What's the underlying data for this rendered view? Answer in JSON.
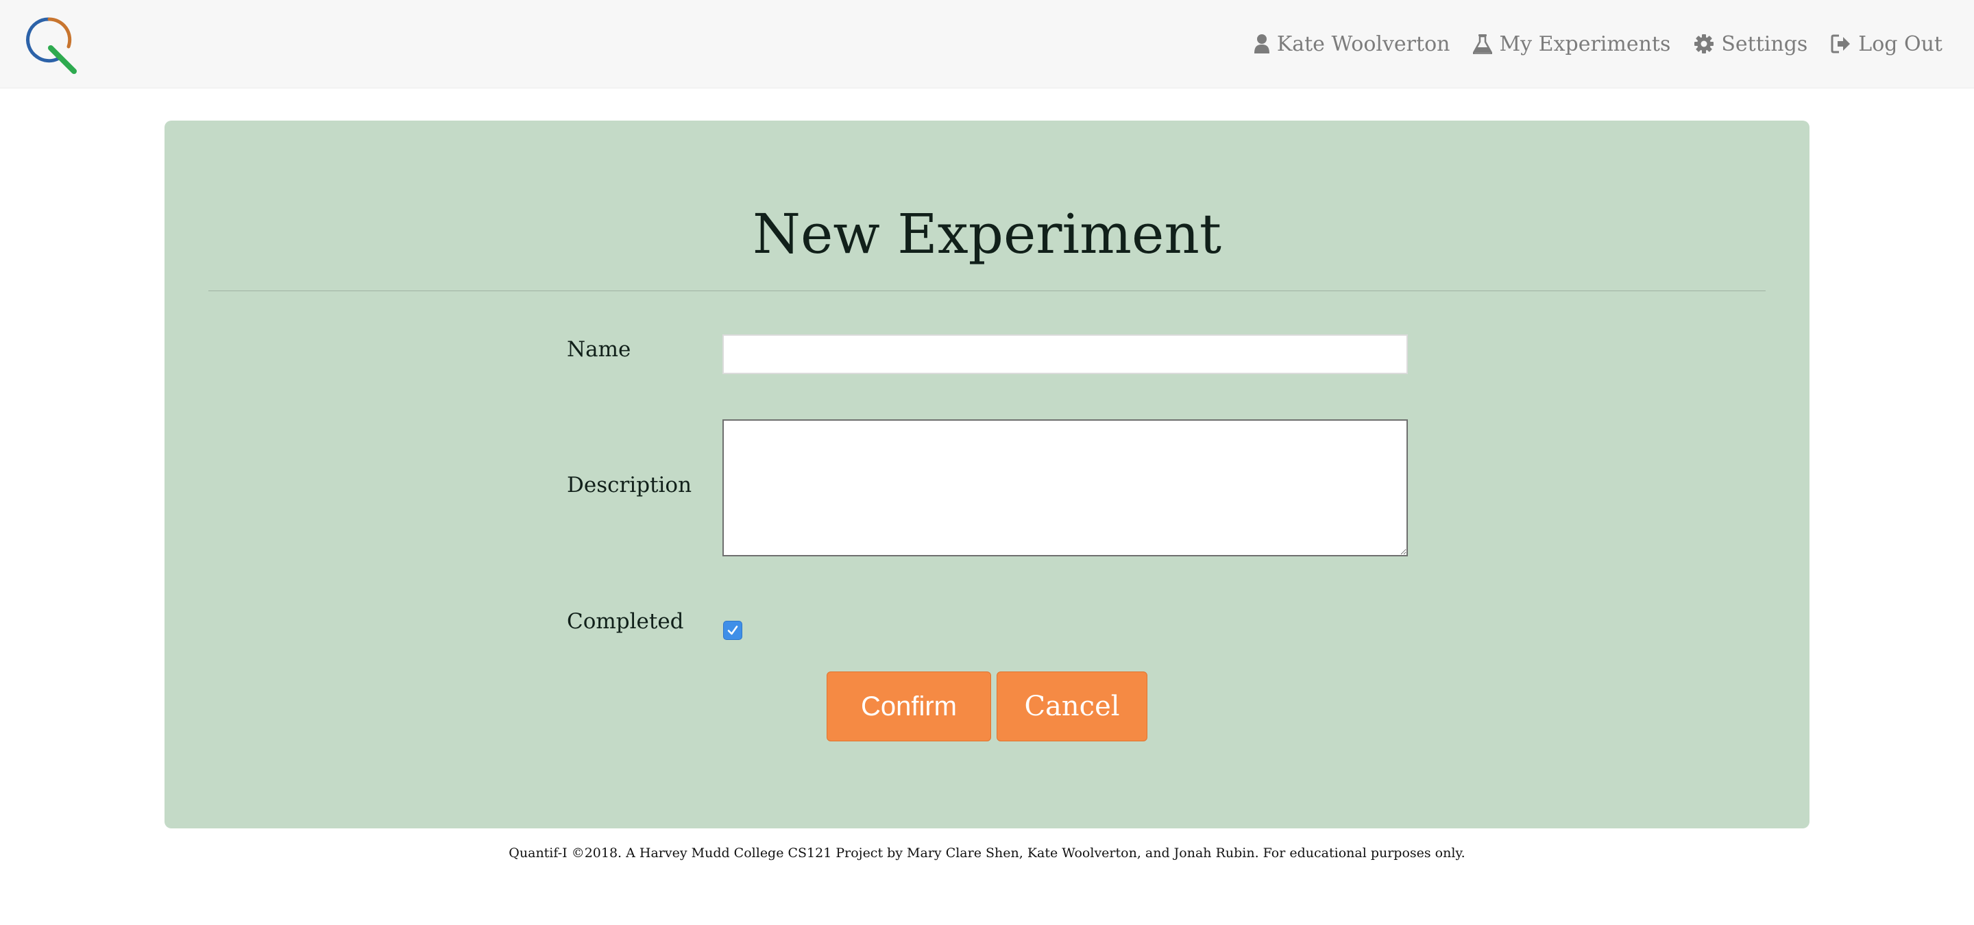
{
  "app": {
    "logo_icon": "quantif-i-magnifier-logo"
  },
  "nav": {
    "items": [
      {
        "icon": "user-icon",
        "label": "Kate Woolverton"
      },
      {
        "icon": "flask-icon",
        "label": "My Experiments"
      },
      {
        "icon": "gear-icon",
        "label": "Settings"
      },
      {
        "icon": "sign-out-icon",
        "label": "Log Out"
      }
    ]
  },
  "form": {
    "title": "New Experiment",
    "name_label": "Name",
    "name_value": "",
    "description_label": "Description",
    "description_value": "",
    "completed_label": "Completed",
    "completed_checked": true,
    "confirm_label": "Confirm",
    "cancel_label": "Cancel"
  },
  "footer": {
    "text": "Quantif-I ©2018. A Harvey Mudd College CS121 Project by Mary Clare Shen, Kate Woolverton, and Jonah Rubin. For educational purposes only."
  },
  "colors": {
    "navbar_bg": "#f7f7f7",
    "panel_bg": "#c4dac7",
    "button_bg": "#f58a44",
    "checkbox_bg": "#3f8fe8",
    "nav_text": "#7c7c7c",
    "logo_blue": "#2c62a8",
    "logo_orange": "#c8752f",
    "logo_green": "#2eaa4f"
  }
}
